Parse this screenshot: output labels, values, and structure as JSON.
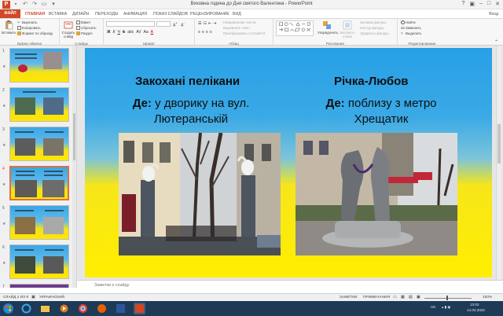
{
  "window": {
    "title": "Виховна година до Дня святого Валентина - PowerPoint"
  },
  "tabs": [
    {
      "label": "ФАЙЛ"
    },
    {
      "label": "ГЛАВНАЯ"
    },
    {
      "label": "ВСТАВКА"
    },
    {
      "label": "ДИЗАЙН"
    },
    {
      "label": "ПЕРЕХОДЫ"
    },
    {
      "label": "АНИМАЦИЯ"
    },
    {
      "label": "ПОКАЗ СЛАЙДОВ"
    },
    {
      "label": "РЕЦЕНЗИРОВАНИЕ"
    },
    {
      "label": "ВИД"
    }
  ],
  "signin": "Вход",
  "ribbon": {
    "clipboard": {
      "paste": "Вставить",
      "cut": "Вырезать",
      "copy": "Копировать",
      "format_painter": "Формат по образцу",
      "label": "Буфер обмена"
    },
    "slides": {
      "new_slide": "Создать слайд",
      "layout": "Макет",
      "reset": "Сбросить",
      "section": "Раздел",
      "label": "Слайды"
    },
    "font": {
      "label": "Шрифт",
      "bold": "Ж",
      "italic": "К",
      "underline": "Ч",
      "strike": "S",
      "shadow": "abc",
      "spacing": "AV",
      "case": "Aa",
      "color": "A"
    },
    "paragraph": {
      "text_direction": "Направление текста",
      "align_text": "Выровнять текст",
      "smartart": "Преобразовать в SmartArt",
      "label": "Абзац"
    },
    "drawing": {
      "arrange": "Упорядочить",
      "quick_styles": "Экспресс-стили",
      "fill": "Заливка фигуры",
      "outline": "Контур фигуры",
      "effects": "Эффекты фигуры",
      "label": "Рисование"
    },
    "editing": {
      "find": "Найти",
      "replace": "Заменить",
      "select": "Выделить",
      "label": "Редактирование"
    }
  },
  "thumbnails": [
    {
      "number": "1"
    },
    {
      "number": "2"
    },
    {
      "number": "3"
    },
    {
      "number": "4"
    },
    {
      "number": "5"
    },
    {
      "number": "6"
    },
    {
      "number": "7"
    }
  ],
  "slide": {
    "left": {
      "title": "Закохані пелікани",
      "where_label": "Де:",
      "where_line1": " у дворику на вул.",
      "where_line2": "Лютеранській"
    },
    "right": {
      "title": "Річка-Любов",
      "where_label": "Де:",
      "where_line1": " поблизу з метро",
      "where_line2": "Хрещатик"
    }
  },
  "notes": {
    "placeholder": "Заметки к слайду"
  },
  "status": {
    "slide_info": "СЛАЙД 4 ИЗ 9",
    "language": "УКРАИНСКИЙ",
    "notes_btn": "ЗАМЕТКИ",
    "comments_btn": "ПРИМЕЧАНИЯ",
    "zoom": "100%"
  },
  "taskbar": {
    "lang": "UK",
    "time": "13:02",
    "date": "14.02.2022"
  },
  "colors": {
    "accent": "#d24726",
    "slide_blue": "#27a0e6",
    "slide_yellow": "#ffee00",
    "taskbar": "#1d3a57"
  }
}
